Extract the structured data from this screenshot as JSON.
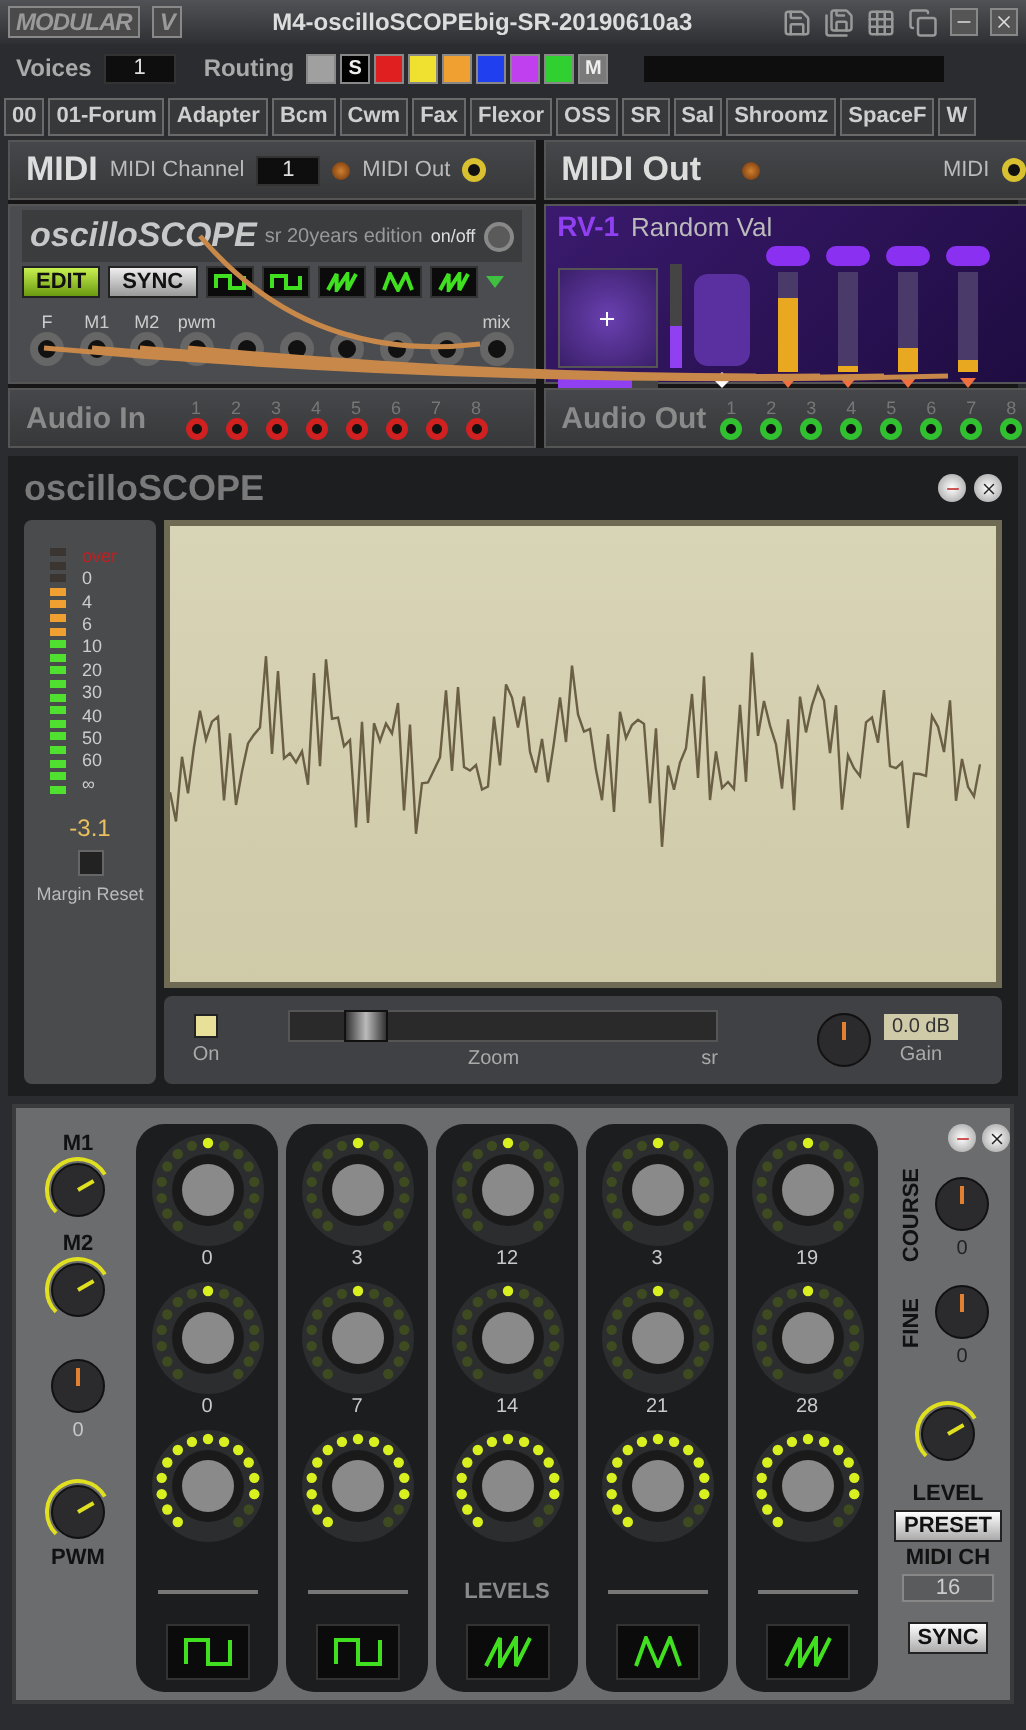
{
  "window": {
    "logo": "MODULAR",
    "logo_badge": "V",
    "title": "M4-oscilloSCOPEbig-SR-20190610a3"
  },
  "toolbar": {
    "voices_label": "Voices",
    "voices": "1",
    "routing_label": "Routing",
    "routing": [
      {
        "color": "#a0a0a0"
      },
      {
        "label": "S",
        "color": "#000000"
      },
      {
        "color": "#e02020"
      },
      {
        "color": "#f0e030"
      },
      {
        "color": "#f0a030"
      },
      {
        "color": "#2040f0"
      },
      {
        "color": "#c040f0"
      },
      {
        "color": "#30d030"
      },
      {
        "label": "M",
        "color": "#7a7a7a"
      }
    ]
  },
  "preset_tabs": [
    "00",
    "01-Forum",
    "Adapter",
    "Bcm",
    "Cwm",
    "Fax",
    "Flexor",
    "OSS",
    "SR",
    "Sal",
    "Shroomz",
    "SpaceF",
    "W"
  ],
  "rack": {
    "midi": {
      "title": "MIDI",
      "channel_label": "MIDI Channel",
      "channel": "1",
      "out_label": "MIDI Out"
    },
    "midi_out": {
      "title": "MIDI Out",
      "port_label": "MIDI"
    },
    "scope_module": {
      "name": "oscilloSCOPE",
      "subtitle": "sr 20years edition",
      "switch": {
        "label": "on/off",
        "on": true
      },
      "buttons": [
        {
          "label": "EDIT",
          "on": true
        },
        {
          "label": "SYNC",
          "on": false
        }
      ],
      "waves": [
        {
          "kind": "square"
        },
        {
          "kind": "square"
        },
        {
          "kind": "saw"
        },
        {
          "kind": "triangle"
        },
        {
          "kind": "saw"
        }
      ],
      "jacks": [
        {
          "kind": "jack",
          "label": "F"
        },
        {
          "kind": "jack",
          "label": "M1"
        },
        {
          "kind": "jack",
          "label": "M2"
        },
        {
          "kind": "jack",
          "label": "pwm"
        },
        {
          "kind": "jack"
        },
        {
          "kind": "jack"
        },
        {
          "kind": "jack"
        },
        {
          "kind": "jack"
        },
        {
          "kind": "jack"
        },
        {
          "kind": "jack",
          "label": "mix"
        }
      ]
    },
    "random_val": {
      "logo": "RV-1",
      "title": "Random Val",
      "pad_meter": {
        "level": 0.4
      },
      "spread_meter": {
        "level": 0.75
      },
      "sliders": [
        {
          "level": 0.75
        },
        {
          "level": 0.06
        },
        {
          "level": 0.25
        },
        {
          "level": 0.12
        }
      ]
    },
    "audio_in": {
      "title": "Audio In",
      "ports": [
        "1",
        "2",
        "3",
        "4",
        "5",
        "6",
        "7",
        "8"
      ]
    },
    "audio_out": {
      "title": "Audio Out",
      "ports": [
        "1",
        "2",
        "3",
        "4",
        "5",
        "6",
        "7",
        "8"
      ]
    }
  },
  "scope": {
    "title": "oscilloSCOPE",
    "meter": {
      "labels": [
        "over",
        "0",
        "4",
        "6",
        "10",
        "20",
        "30",
        "40",
        "50",
        "60",
        "∞"
      ],
      "level": 0.84,
      "reading": "-3.1",
      "reset_label": "Margin Reset"
    },
    "controls": {
      "on_label": "On",
      "on": true,
      "zoom": {
        "label": "Zoom",
        "level": 0.18
      },
      "sr_label": "sr",
      "gain": {
        "value": "0.0 dB",
        "label": "Gain"
      }
    }
  },
  "synth": {
    "mod_knobs": [
      {
        "kind": "arc",
        "label": "M1"
      },
      {
        "kind": "arc",
        "label": "M2"
      },
      {
        "kind": "plain",
        "value": "0"
      },
      {
        "kind": "arc",
        "label": "PWM"
      }
    ],
    "columns": [
      {
        "wave": {
          "kind": "square"
        },
        "knobs": [
          {
            "kind": "bipolar",
            "value": "0"
          },
          {
            "kind": "bipolar",
            "value": "0"
          },
          {
            "kind": "unipolar"
          }
        ]
      },
      {
        "wave": {
          "kind": "square"
        },
        "knobs": [
          {
            "kind": "bipolar",
            "value": "3"
          },
          {
            "kind": "bipolar",
            "value": "7"
          },
          {
            "kind": "unipolar"
          }
        ]
      },
      {
        "wave": {
          "kind": "saw"
        },
        "knobs": [
          {
            "kind": "bipolar",
            "value": "12"
          },
          {
            "kind": "bipolar",
            "value": "14"
          },
          {
            "kind": "unipolar"
          }
        ]
      },
      {
        "wave": {
          "kind": "triangle"
        },
        "knobs": [
          {
            "kind": "bipolar",
            "value": "3"
          },
          {
            "kind": "bipolar",
            "value": "21"
          },
          {
            "kind": "unipolar"
          }
        ]
      },
      {
        "wave": {
          "kind": "saw"
        },
        "knobs": [
          {
            "kind": "bipolar",
            "value": "19"
          },
          {
            "kind": "bipolar",
            "value": "28"
          },
          {
            "kind": "unipolar"
          }
        ]
      }
    ],
    "levels_label": "LEVELS",
    "course": {
      "label": "COURSE",
      "value": "0"
    },
    "fine": {
      "label": "FINE",
      "value": "0"
    },
    "level_knob": {
      "label": "LEVEL"
    },
    "preset_button": "PRESET",
    "midi_ch_label": "MIDI CH",
    "midi_ch": "16",
    "sync_button": "SYNC"
  }
}
